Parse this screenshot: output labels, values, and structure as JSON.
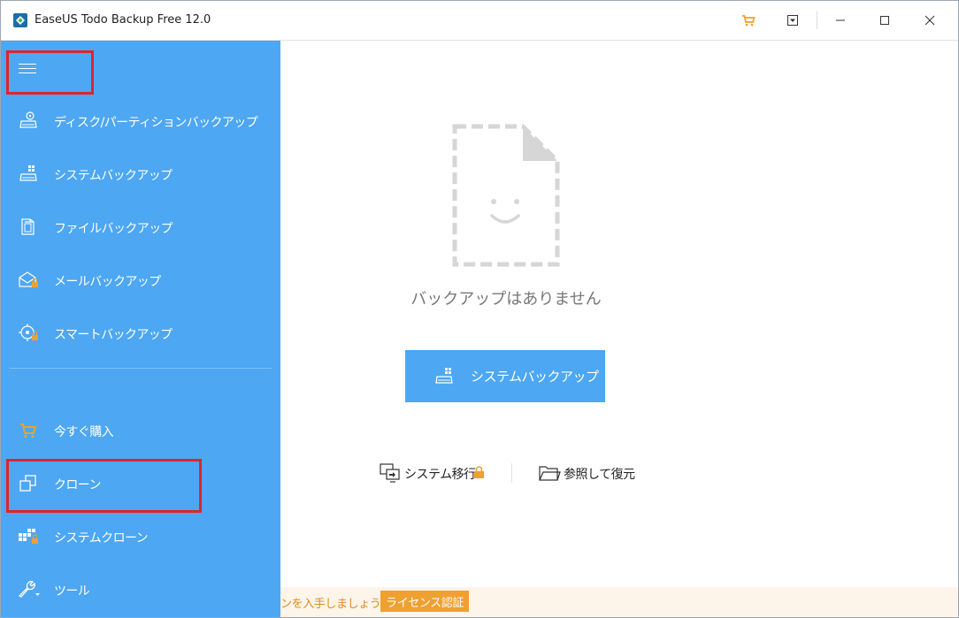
{
  "window": {
    "title": "EaseUS Todo Backup Free 12.0"
  },
  "sidebar": {
    "items": [
      {
        "label": "ディスク/パーティションバックアップ",
        "icon": "disk-backup-icon"
      },
      {
        "label": "システムバックアップ",
        "icon": "system-backup-icon"
      },
      {
        "label": "ファイルバックアップ",
        "icon": "file-backup-icon"
      },
      {
        "label": "メールバックアップ",
        "icon": "mail-backup-icon"
      },
      {
        "label": "スマートバックアップ",
        "icon": "smart-backup-icon"
      }
    ],
    "bottom_items": [
      {
        "label": "今すぐ購入",
        "icon": "cart-icon"
      },
      {
        "label": "クローン",
        "icon": "clone-icon"
      },
      {
        "label": "システムクローン",
        "icon": "system-clone-icon"
      },
      {
        "label": "ツール",
        "icon": "wrench-icon"
      }
    ]
  },
  "main": {
    "empty_message": "バックアップはありません",
    "primary_button": "システムバックアップ",
    "links": {
      "migrate": "システム移行",
      "browse_restore": "参照して復元"
    }
  },
  "banner": {
    "text": "ンを入手しましょう。",
    "button": "ライセンス認証"
  },
  "colors": {
    "sidebar_bg": "#4da7f2",
    "accent_orange": "#f0a030",
    "highlight_red": "#e0242b"
  }
}
